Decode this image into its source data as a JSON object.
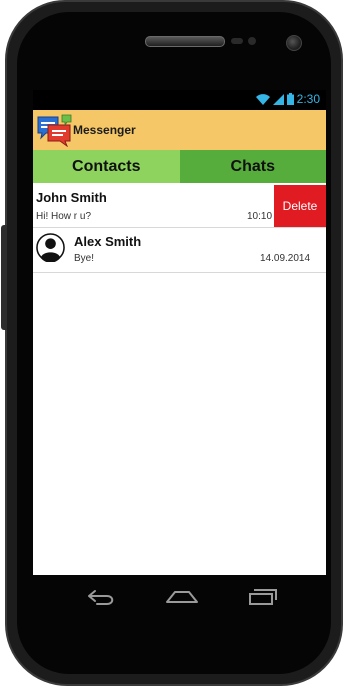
{
  "status_bar": {
    "time": "2:30"
  },
  "app_bar": {
    "title": "Messenger",
    "icon": "messenger-app-icon"
  },
  "tabs": [
    {
      "label": "Contacts",
      "color": "#8ed35d"
    },
    {
      "label": "Chats",
      "color": "#57ad3b"
    }
  ],
  "chats": [
    {
      "name": "John Smith",
      "message": "Hi! How r u?",
      "time": "10:10",
      "action": "Delete"
    },
    {
      "name": "Alex Smith",
      "message": "Bye!",
      "time": "14.09.2014",
      "avatar": "person-avatar-icon"
    }
  ],
  "colors": {
    "app_bar": "#f5c766",
    "delete": "#e11b22",
    "status_icons": "#35b5e5"
  },
  "nav": {
    "back": "back-icon",
    "home": "home-icon",
    "recents": "recents-icon"
  }
}
